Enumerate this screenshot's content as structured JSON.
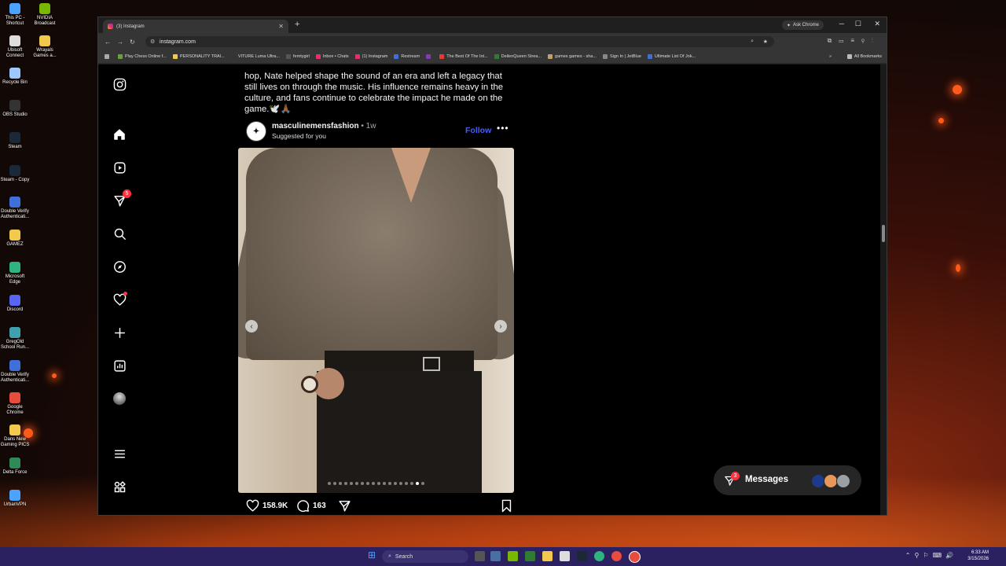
{
  "desktop": {
    "icons": [
      {
        "label": "This PC - Shortcut",
        "color": "#4aa3ff"
      },
      {
        "label": "NVIDIA Broadcast",
        "color": "#76b900"
      },
      {
        "label": "Ubisoft Connect",
        "color": "#dddddd"
      },
      {
        "label": "Wrayals Games a...",
        "color": "#f2c94c"
      },
      {
        "label": "Recycle Bin",
        "color": "#9ec9ff"
      },
      {
        "label": "OBS Studio",
        "color": "#333333"
      },
      {
        "label": "Steam",
        "color": "#1b2838"
      },
      {
        "label": "Steam - Copy",
        "color": "#1b2838"
      },
      {
        "label": "Double Verify Authenticati...",
        "color": "#3f6fd8"
      },
      {
        "label": "GAMEZ",
        "color": "#f2c94c"
      },
      {
        "label": "Microsoft Edge",
        "color": "#2fb37f"
      },
      {
        "label": "Discord",
        "color": "#5865f2"
      },
      {
        "label": "GregOld School Run...",
        "color": "#3fa0b0"
      },
      {
        "label": "Double Verify Authenticati...",
        "color": "#3f6fd8"
      },
      {
        "label": "Google Chrome",
        "color": "#e74c3c"
      },
      {
        "label": "Dans New Gaming PICS",
        "color": "#f2c94c"
      },
      {
        "label": "Delta Force",
        "color": "#2e8b57"
      },
      {
        "label": "UrbanVPN",
        "color": "#4aa3ff"
      }
    ]
  },
  "browser": {
    "tab_title": "(3) Instagram",
    "new_tab": "+",
    "ask_chrome": "Ask Chrome",
    "url": "instagram.com",
    "bookmarks": [
      "Play Chess Online f...",
      "PERSONALITY TRAI...",
      "VITURE Luma Ultra...",
      "femtygirl",
      "Inbox • Chats",
      "(1) Instagram",
      "Restream",
      "",
      "The Best Of The Int...",
      "DeilenQueen Strea...",
      "games games - sha...",
      "Sign In | JetBlue",
      "Ultimate List Of Jok..."
    ],
    "more_bookmarks": "»",
    "all_bookmarks": "All Bookmarks"
  },
  "instagram": {
    "nav": {
      "notifications_badge": "5"
    },
    "caption": "hop, Nate helped shape the sound of an era and left a legacy that still lives on through the music. His influence remains heavy in the culture, and fans continue to celebrate the impact he made on the game.🕊️🙏🏾",
    "post": {
      "username": "masculinemensfashion",
      "time": " • 1w",
      "subtitle": "Suggested for you",
      "follow": "Follow",
      "more": "•••",
      "likes": "158.9K",
      "comments": "163",
      "slide_count": 18,
      "active_slide": 16
    },
    "messages": {
      "label": "Messages",
      "badge": "3"
    }
  },
  "taskbar": {
    "search_label": "Search",
    "time": "6:33 AM",
    "date": "3/15/2026"
  }
}
